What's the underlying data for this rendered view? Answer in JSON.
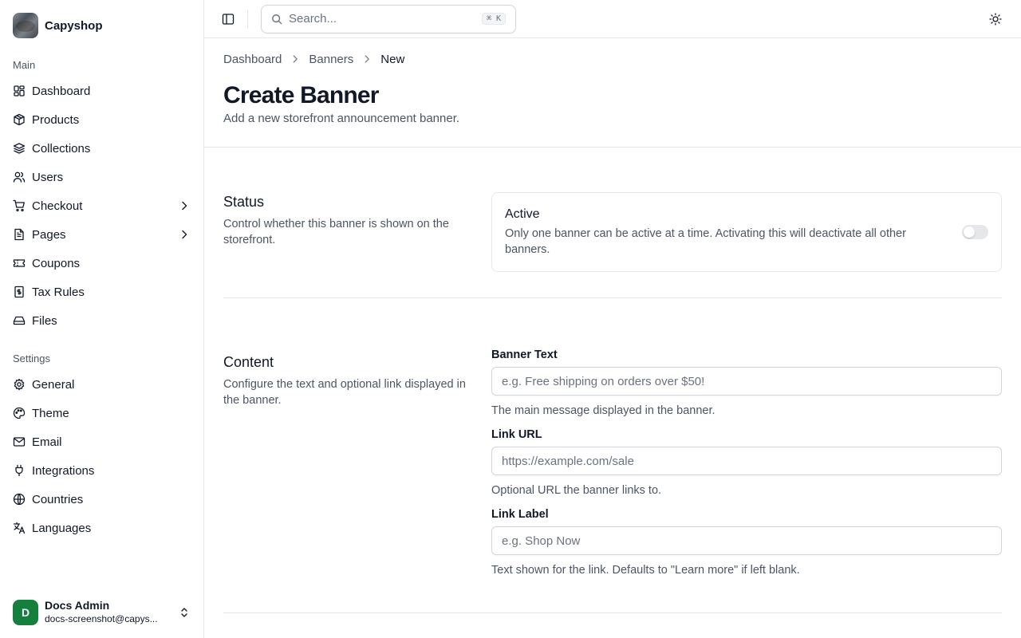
{
  "brand": {
    "name": "Capyshop"
  },
  "sidebar": {
    "main_label": "Main",
    "main_items": [
      {
        "label": "Dashboard",
        "icon": "dashboard-icon"
      },
      {
        "label": "Products",
        "icon": "package-icon"
      },
      {
        "label": "Collections",
        "icon": "layers-icon"
      },
      {
        "label": "Users",
        "icon": "users-icon"
      },
      {
        "label": "Checkout",
        "icon": "cart-icon",
        "has_children": true
      },
      {
        "label": "Pages",
        "icon": "file-icon",
        "has_children": true
      },
      {
        "label": "Coupons",
        "icon": "ticket-icon"
      },
      {
        "label": "Tax Rules",
        "icon": "receipt-icon"
      },
      {
        "label": "Files",
        "icon": "hard-drive-icon"
      }
    ],
    "settings_label": "Settings",
    "settings_items": [
      {
        "label": "General",
        "icon": "gear-icon"
      },
      {
        "label": "Theme",
        "icon": "palette-icon"
      },
      {
        "label": "Email",
        "icon": "mail-icon"
      },
      {
        "label": "Integrations",
        "icon": "plug-icon"
      },
      {
        "label": "Countries",
        "icon": "globe-icon"
      },
      {
        "label": "Languages",
        "icon": "translate-icon"
      }
    ],
    "user": {
      "initial": "D",
      "name": "Docs Admin",
      "email": "docs-screenshot@capys..."
    }
  },
  "topbar": {
    "search_placeholder": "Search...",
    "shortcut": "⌘ K"
  },
  "header": {
    "breadcrumb": [
      "Dashboard",
      "Banners",
      "New"
    ],
    "title": "Create Banner",
    "subtitle": "Add a new storefront announcement banner."
  },
  "status_section": {
    "title": "Status",
    "description": "Control whether this banner is shown on the storefront.",
    "card_title": "Active",
    "card_description": "Only one banner can be active at a time. Activating this will deactivate all other banners.",
    "active": false
  },
  "content_section": {
    "title": "Content",
    "description": "Configure the text and optional link displayed in the banner.",
    "fields": {
      "banner_text": {
        "label": "Banner Text",
        "value": "",
        "placeholder": "e.g. Free shipping on orders over $50!",
        "help": "The main message displayed in the banner."
      },
      "link_url": {
        "label": "Link URL",
        "value": "",
        "placeholder": "https://example.com/sale",
        "help": "Optional URL the banner links to."
      },
      "link_label": {
        "label": "Link Label",
        "value": "",
        "placeholder": "e.g. Shop Now",
        "help": "Text shown for the link. Defaults to \"Learn more\" if left blank."
      }
    }
  },
  "colors": {
    "avatar": "#15803d",
    "border": "#e5e7eb",
    "muted_text": "#4b5563"
  }
}
